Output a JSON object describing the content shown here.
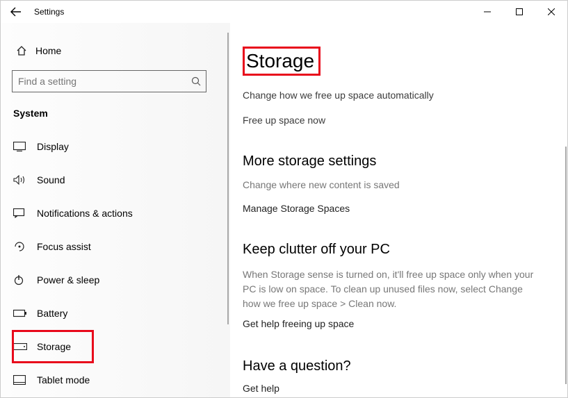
{
  "window": {
    "title": "Settings"
  },
  "sidebar": {
    "home": "Home",
    "search_placeholder": "Find a setting",
    "group": "System",
    "items": [
      {
        "label": "Display"
      },
      {
        "label": "Sound"
      },
      {
        "label": "Notifications & actions"
      },
      {
        "label": "Focus assist"
      },
      {
        "label": "Power & sleep"
      },
      {
        "label": "Battery"
      },
      {
        "label": "Storage"
      },
      {
        "label": "Tablet mode"
      }
    ]
  },
  "main": {
    "title": "Storage",
    "link_change": "Change how we free up space automatically",
    "link_free": "Free up space now",
    "more_header": "More storage settings",
    "more_sub": "Change where new content is saved",
    "more_link": "Manage Storage Spaces",
    "keep_header": "Keep clutter off your PC",
    "keep_desc": "When Storage sense is turned on, it'll free up space only when your PC is low on space. To clean up unused files now, select Change how we free up space > Clean now.",
    "keep_link": "Get help freeing up space",
    "question_header": "Have a question?",
    "question_link": "Get help"
  }
}
